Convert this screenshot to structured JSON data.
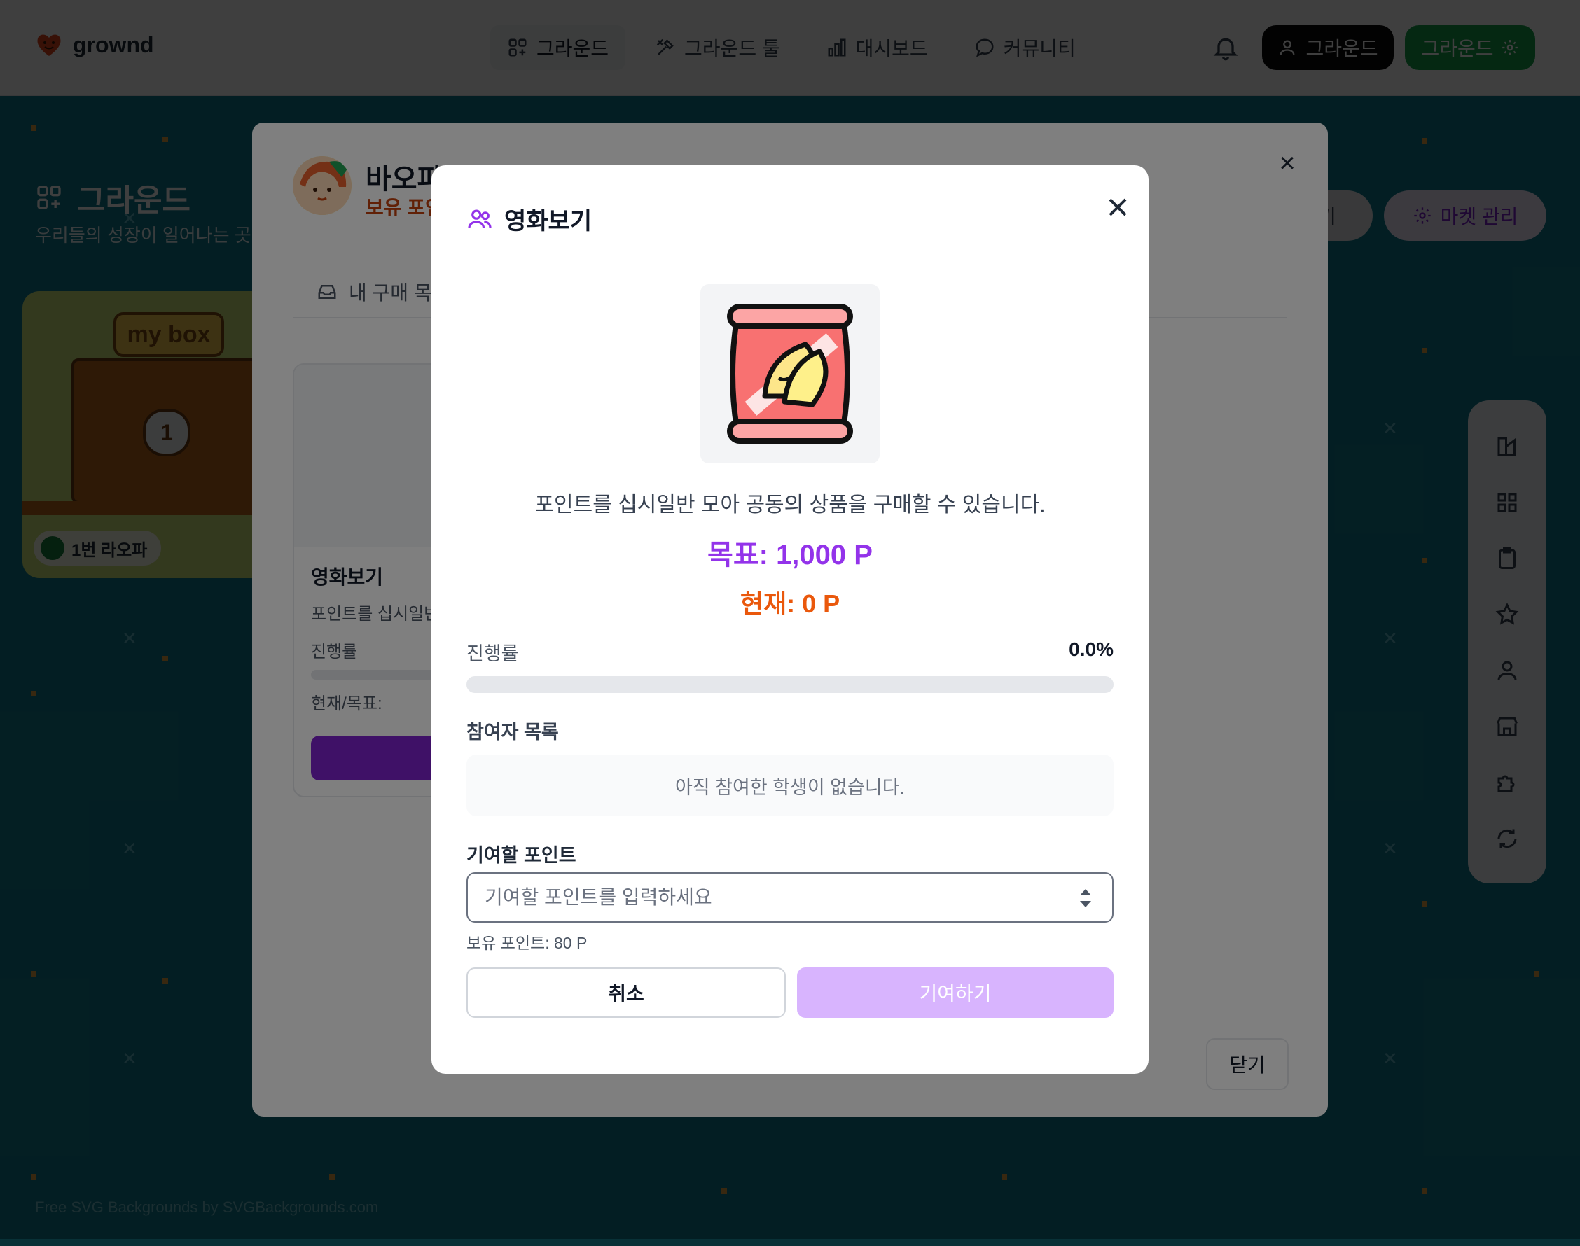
{
  "nav": {
    "brand": "grownd",
    "links": [
      {
        "label": "그라운드",
        "icon": "grid-plus-icon"
      },
      {
        "label": "그라운드 툴",
        "icon": "tools-icon"
      },
      {
        "label": "대시보드",
        "icon": "bar-chart-icon"
      },
      {
        "label": "커뮤니티",
        "icon": "chat-bubble-icon"
      }
    ],
    "user_button": "그라운드",
    "settings_button": "그라운드"
  },
  "page": {
    "title": "그라운드",
    "subtitle": "우리들의 성장이 일어나는 곳",
    "mybox_sign": "my box",
    "mybox_number": "1",
    "mybox_student": "1번 라오파",
    "right_button": "기",
    "market_manage": "마켓 관리",
    "footer_credit": "Free SVG Backgrounds by SVGBackgrounds.com"
  },
  "market": {
    "title": "바오파 님의 마켓",
    "points": "보유 포인",
    "tab_label": "내 구매 목록",
    "card": {
      "name": "영화보기",
      "desc": "포인트를 십시일반",
      "progress_label": "진행률",
      "current_label": "현재/목표:"
    },
    "close_button": "닫기"
  },
  "dialog": {
    "title": "영화보기",
    "description": "포인트를 십시일반 모아 공동의 상품을 구매할 수 있습니다.",
    "goal_text": "목표: 1,000 P",
    "current_text": "현재: 0 P",
    "progress_label": "진행률",
    "progress_text": "0.0%",
    "progress_fraction": 0.0,
    "participants_label": "참여자 목록",
    "participants_empty": "아직 참여한 학생이 없습니다.",
    "contribute_label": "기여할 포인트",
    "input_placeholder": "기여할 포인트를 입력하세요",
    "input_value": "",
    "owned_points": "보유 포인트: 80 P",
    "cancel_label": "취소",
    "contribute_button": "기여하기"
  },
  "colors": {
    "accent": "#9333ea",
    "current": "#ea580c",
    "contribute_disabled": "#d8b4fe",
    "bg_teal": "#0f7b8f",
    "green": "#16a34a"
  }
}
